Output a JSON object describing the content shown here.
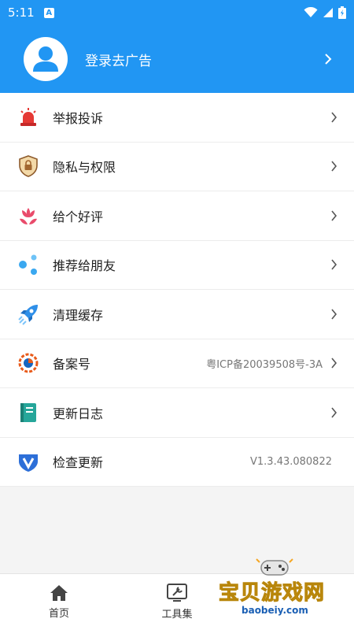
{
  "status_bar": {
    "time": "5:11",
    "notif_letter": "A"
  },
  "header": {
    "login_text": "登录去广告"
  },
  "menu": [
    {
      "label": "举报投诉",
      "icon": "alarm-siren-icon"
    },
    {
      "label": "隐私与权限",
      "icon": "lock-shield-icon"
    },
    {
      "label": "给个好评",
      "icon": "flower-icon"
    },
    {
      "label": "推荐给朋友",
      "icon": "share-icon"
    },
    {
      "label": "清理缓存",
      "icon": "rocket-icon"
    },
    {
      "label": "备案号",
      "value": "粤ICP备20039508号-3A",
      "icon": "record-icon"
    },
    {
      "label": "更新日志",
      "icon": "notebook-icon"
    },
    {
      "label": "检查更新",
      "value": "V1.3.43.080822",
      "icon": "version-v-icon"
    }
  ],
  "bottom_nav": [
    {
      "label": "首页",
      "icon": "home-icon"
    },
    {
      "label": "工具集",
      "icon": "tools-icon"
    }
  ],
  "watermark": {
    "text": "宝贝游戏网",
    "url": "baobeiy.com"
  },
  "colors": {
    "primary": "#2196f3",
    "siren": "#e53935",
    "flower": "#e94b6b",
    "share": "#3aa8f0",
    "notebook": "#26a69a"
  }
}
